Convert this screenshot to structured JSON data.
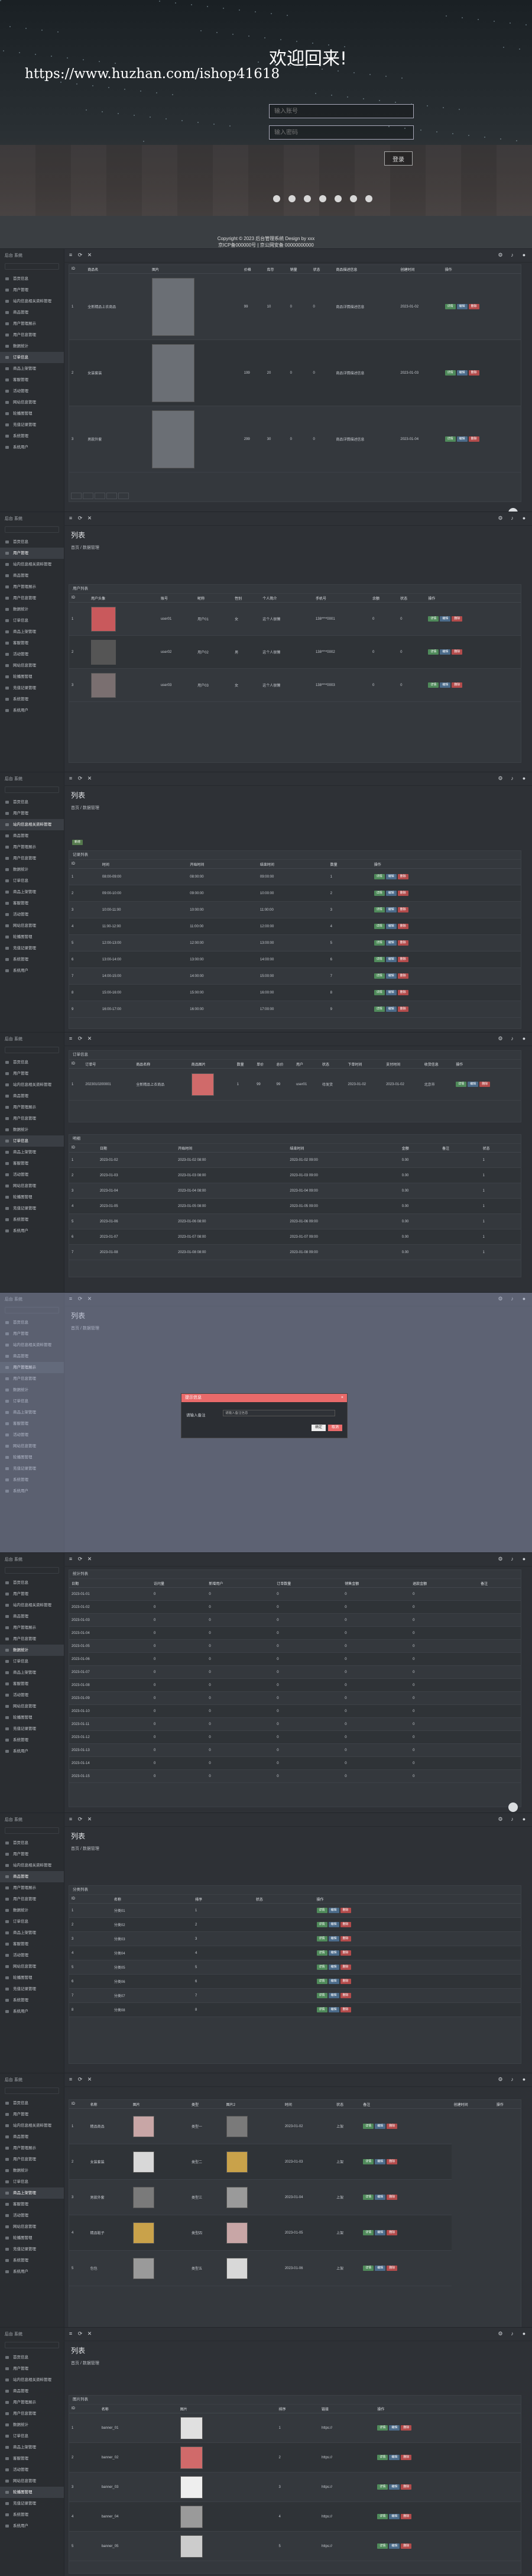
{
  "login": {
    "welcome": "欢迎回来!",
    "watermark": "https://www.huzhan.com/ishop41618",
    "account_placeholder": "输入账号",
    "password_placeholder": "输入密码",
    "login_button": "登录",
    "copyright_line1": "Copyright © 2023 后台管理系统 Design by xxx",
    "copyright_line2": "京ICP备000000号 | 京公网安备 00000000000"
  },
  "sidebar": {
    "logo": "后台 系统",
    "items": [
      "首页信息",
      "用户管理",
      "站内信息相关资料管理",
      "商品管理",
      "用户管理展示",
      "用户信息管理",
      "数据统计",
      "订单信息",
      "商品上架管理",
      "客服管理",
      "活动管理",
      "网站信息管理",
      "轮播图管理",
      "充值记录管理",
      "系统管理",
      "系统用户"
    ]
  },
  "colors": {
    "accent": "#e96a6a",
    "edit": "#4b6b8a",
    "del": "#b34b4b",
    "view": "#4f8a5a"
  },
  "icons": [
    "menu-icon",
    "refresh-icon",
    "close-icon",
    "settings-icon",
    "bell-icon",
    "user-icon"
  ],
  "page_titles": {
    "list": "列表",
    "crumb": "首页 / 数据管理"
  },
  "buttons": {
    "edit": "编辑",
    "del": "删除",
    "view": "详情",
    "add": "新增"
  },
  "section1": {
    "columns": [
      "ID",
      "商品名",
      "图片",
      "价格",
      "库存",
      "销量",
      "状态",
      "商品描述信息",
      "创建时间",
      "操作"
    ],
    "rows": [
      {
        "id": "1",
        "name": "全新精品上衣商品",
        "price": "99",
        "stock": "10",
        "sales": "0",
        "state": "0",
        "desc": "商品详情描述信息",
        "time": "2023-01-02"
      },
      {
        "id": "2",
        "name": "女装套装",
        "price": "199",
        "stock": "20",
        "sales": "0",
        "state": "0",
        "desc": "商品详情描述信息",
        "time": "2023-01-03"
      },
      {
        "id": "3",
        "name": "男款外套",
        "price": "299",
        "stock": "30",
        "sales": "0",
        "state": "0",
        "desc": "商品详情描述信息",
        "time": "2023-01-04"
      }
    ]
  },
  "section2": {
    "head": "用户列表",
    "columns": [
      "ID",
      "用户头像",
      "账号",
      "昵称",
      "性别",
      "个人简介",
      "手机号",
      "余额",
      "状态",
      "操作"
    ],
    "rows": [
      {
        "id": "1",
        "acc": "user01",
        "nick": "用户01",
        "sex": "女",
        "intro": "这个人很懒",
        "phone": "138****0001",
        "bal": "0",
        "st": "0"
      },
      {
        "id": "2",
        "acc": "user02",
        "nick": "用户02",
        "sex": "男",
        "intro": "这个人很懒",
        "phone": "138****0002",
        "bal": "0",
        "st": "0"
      },
      {
        "id": "3",
        "acc": "user03",
        "nick": "用户03",
        "sex": "女",
        "intro": "这个人很懒",
        "phone": "138****0003",
        "bal": "0",
        "st": "0"
      }
    ]
  },
  "section3": {
    "head": "记录列表",
    "columns": [
      "ID",
      "时间",
      "开始时间",
      "结束时间",
      "数量",
      "操作"
    ],
    "rows": [
      [
        "1",
        "08:00-09:00",
        "08:00:00",
        "09:00:00",
        "1"
      ],
      [
        "2",
        "09:00-10:00",
        "09:00:00",
        "10:00:00",
        "2"
      ],
      [
        "3",
        "10:00-11:00",
        "10:00:00",
        "11:00:00",
        "3"
      ],
      [
        "4",
        "11:00-12:00",
        "11:00:00",
        "12:00:00",
        "4"
      ],
      [
        "5",
        "12:00-13:00",
        "12:00:00",
        "13:00:00",
        "5"
      ],
      [
        "6",
        "13:00-14:00",
        "13:00:00",
        "14:00:00",
        "6"
      ],
      [
        "7",
        "14:00-15:00",
        "14:00:00",
        "15:00:00",
        "7"
      ],
      [
        "8",
        "15:00-16:00",
        "15:00:00",
        "16:00:00",
        "8"
      ],
      [
        "9",
        "16:00-17:00",
        "16:00:00",
        "17:00:00",
        "9"
      ]
    ]
  },
  "section4": {
    "head": "订单信息",
    "columns": [
      "ID",
      "订单号",
      "商品名称",
      "商品图片",
      "数量",
      "单价",
      "总价",
      "用户",
      "状态",
      "下单时间",
      "支付时间",
      "收货信息",
      "操作"
    ],
    "row": [
      "1",
      "2023010200001",
      "全新精品上衣商品",
      "1",
      "99",
      "99",
      "user01",
      "待发货",
      "2023-01-02",
      "2023-01-02",
      "北京市"
    ],
    "sub_head": "明细",
    "sub_columns": [
      "ID",
      "日期",
      "开始时间",
      "结束时间",
      "金额",
      "备注",
      "状态"
    ],
    "sub_rows": [
      [
        "1",
        "2023-01-02",
        "2023-01-02 08:00",
        "2023-01-02 09:00",
        "0.00",
        "",
        "1"
      ],
      [
        "2",
        "2023-01-03",
        "2023-01-03 08:00",
        "2023-01-03 09:00",
        "0.00",
        "",
        "1"
      ],
      [
        "3",
        "2023-01-04",
        "2023-01-04 08:00",
        "2023-01-04 09:00",
        "0.00",
        "",
        "1"
      ],
      [
        "4",
        "2023-01-05",
        "2023-01-05 08:00",
        "2023-01-05 09:00",
        "0.00",
        "",
        "1"
      ],
      [
        "5",
        "2023-01-06",
        "2023-01-06 08:00",
        "2023-01-06 09:00",
        "0.00",
        "",
        "1"
      ],
      [
        "6",
        "2023-01-07",
        "2023-01-07 08:00",
        "2023-01-07 09:00",
        "0.00",
        "",
        "1"
      ],
      [
        "7",
        "2023-01-08",
        "2023-01-08 08:00",
        "2023-01-08 09:00",
        "0.00",
        "",
        "1"
      ]
    ]
  },
  "modal": {
    "title": "提示信息",
    "label": "请输入备注",
    "input_value": "请输入备注信息",
    "ok": "确定",
    "cancel": "取消"
  },
  "section6": {
    "head": "统计列表",
    "columns": [
      "日期",
      "访问量",
      "新增用户",
      "订单数量",
      "销售金额",
      "退款金额",
      "备注"
    ],
    "rows": [
      [
        "2023-01-01",
        "0",
        "0",
        "0",
        "0",
        "0",
        ""
      ],
      [
        "2023-01-02",
        "0",
        "0",
        "0",
        "0",
        "0",
        ""
      ],
      [
        "2023-01-03",
        "0",
        "0",
        "0",
        "0",
        "0",
        ""
      ],
      [
        "2023-01-04",
        "0",
        "0",
        "0",
        "0",
        "0",
        ""
      ],
      [
        "2023-01-05",
        "0",
        "0",
        "0",
        "0",
        "0",
        ""
      ],
      [
        "2023-01-06",
        "0",
        "0",
        "0",
        "0",
        "0",
        ""
      ],
      [
        "2023-01-07",
        "0",
        "0",
        "0",
        "0",
        "0",
        ""
      ],
      [
        "2023-01-08",
        "0",
        "0",
        "0",
        "0",
        "0",
        ""
      ],
      [
        "2023-01-09",
        "0",
        "0",
        "0",
        "0",
        "0",
        ""
      ],
      [
        "2023-01-10",
        "0",
        "0",
        "0",
        "0",
        "0",
        ""
      ],
      [
        "2023-01-11",
        "0",
        "0",
        "0",
        "0",
        "0",
        ""
      ],
      [
        "2023-01-12",
        "0",
        "0",
        "0",
        "0",
        "0",
        ""
      ],
      [
        "2023-01-13",
        "0",
        "0",
        "0",
        "0",
        "0",
        ""
      ],
      [
        "2023-01-14",
        "0",
        "0",
        "0",
        "0",
        "0",
        ""
      ],
      [
        "2023-01-15",
        "0",
        "0",
        "0",
        "0",
        "0",
        ""
      ]
    ]
  },
  "section7": {
    "head": "分类列表",
    "columns": [
      "ID",
      "名称",
      "排序",
      "状态",
      "操作"
    ],
    "rows": [
      [
        "1",
        "分类01",
        "1",
        ""
      ],
      [
        "2",
        "分类02",
        "2",
        ""
      ],
      [
        "3",
        "分类03",
        "3",
        ""
      ],
      [
        "4",
        "分类04",
        "4",
        ""
      ],
      [
        "5",
        "分类05",
        "5",
        ""
      ],
      [
        "6",
        "分类06",
        "6",
        ""
      ],
      [
        "7",
        "分类07",
        "7",
        ""
      ],
      [
        "8",
        "分类08",
        "8",
        ""
      ]
    ]
  },
  "section8": {
    "columns": [
      "ID",
      "名称",
      "图片",
      "类型",
      "图片2",
      "时间",
      "状态",
      "备注",
      "创建时间",
      "操作"
    ],
    "rows": [
      [
        "1",
        "精品商品",
        "类型一",
        "2023-01-02",
        "上架"
      ],
      [
        "2",
        "女装套装",
        "类型二",
        "2023-01-03",
        "上架"
      ],
      [
        "3",
        "男款外套",
        "类型三",
        "2023-01-04",
        "上架"
      ],
      [
        "4",
        "精品鞋子",
        "类型四",
        "2023-01-05",
        "上架"
      ],
      [
        "5",
        "包包",
        "类型五",
        "2023-01-06",
        "上架"
      ]
    ]
  },
  "section9": {
    "head": "图片列表",
    "columns": [
      "ID",
      "名称",
      "图片",
      "排序",
      "链接",
      "操作"
    ],
    "rows": [
      [
        "1",
        "banner_01",
        "1",
        "https://"
      ],
      [
        "2",
        "banner_02",
        "2",
        "https://"
      ],
      [
        "3",
        "banner_03",
        "3",
        "https://"
      ],
      [
        "4",
        "banner_04",
        "4",
        "https://"
      ],
      [
        "5",
        "banner_05",
        "5",
        "https://"
      ]
    ]
  }
}
